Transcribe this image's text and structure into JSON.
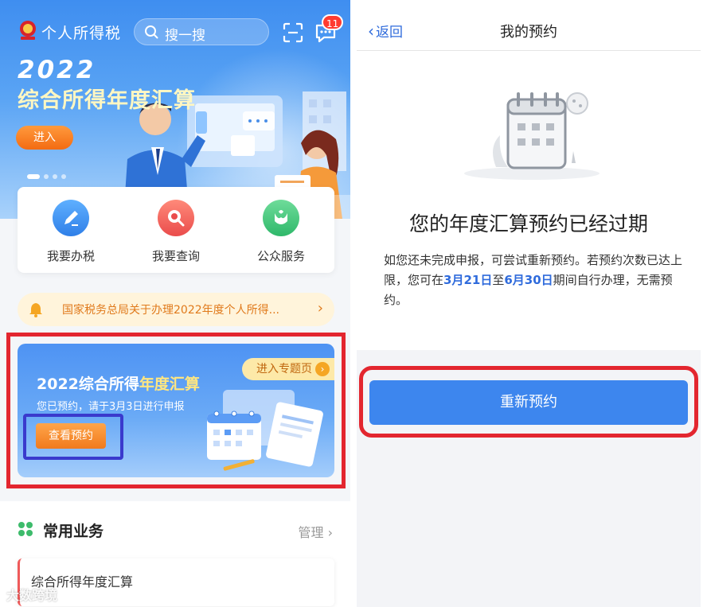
{
  "left": {
    "app_title": "个人所得税",
    "search_placeholder": "搜一搜",
    "message_badge": "11",
    "hero": {
      "year": "2022",
      "title": "综合所得年度汇算",
      "enter_label": "进入"
    },
    "services": [
      {
        "label": "我要办税",
        "icon": "pen-icon"
      },
      {
        "label": "我要查询",
        "icon": "magnifier-icon"
      },
      {
        "label": "公众服务",
        "icon": "flower-icon"
      }
    ],
    "notice": {
      "text": "国家税务总局关于办理2022年度个人所得...",
      "chevron": "›"
    },
    "promo": {
      "title_main": "2022综合所得",
      "title_accent": "年度汇算",
      "subtitle": "您已预约，请于3月3日进行申报",
      "tag_label": "进入专题页",
      "view_button": "查看预约"
    },
    "common": {
      "title": "常用业务",
      "manage_label": "管理 ›",
      "first_item": "综合所得年度汇算"
    },
    "watermark": "大数跨境"
  },
  "right": {
    "back_label": "返回",
    "title": "我的预约",
    "expired_heading": "您的年度汇算预约已经过期",
    "desc_part1": "如您还未完成申报，可尝试重新预约。若预约次数已达上限，您可在",
    "date_start": "3月21日",
    "desc_join": "至",
    "date_end": "6月30日",
    "desc_part2": "期间自行办理，无需预约。",
    "retry_button": "重新预约"
  },
  "colors": {
    "brand_blue": "#3d86ee",
    "highlight_red": "#e3262f",
    "orange": "#f07a1d"
  }
}
